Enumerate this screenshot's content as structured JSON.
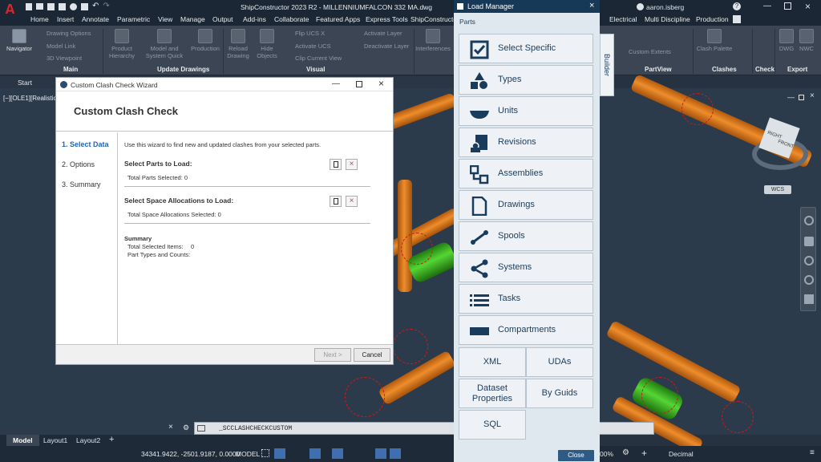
{
  "title_bar": {
    "title": "ShipConstructor 2023 R2 - MILLENNIUMFALCON    332 MA.dwg",
    "user": "aaron.isberg"
  },
  "menu": [
    "Home",
    "Insert",
    "Annotate",
    "Parametric",
    "View",
    "Manage",
    "Output",
    "Add-ins",
    "Collaborate",
    "Featured Apps",
    "Express Tools",
    "ShipConstructor"
  ],
  "menu_right": [
    "Electrical",
    "Multi Discipline",
    "Production"
  ],
  "ribbon": {
    "navigator": "Navigator",
    "drawing_options": "Drawing Options",
    "model_link": "Model Link",
    "viewpoint": "3D Viewpoint",
    "product_hierarchy": "Product Hierarchy",
    "model_system_quick": "Model and System Quick",
    "production": "Production",
    "reload_drawing": "Reload Drawing",
    "hide_objects": "Hide Objects",
    "flip_ucs": "Flip UCS X",
    "activate_ucs": "Activate UCS",
    "clip_current_view": "Clip Current View",
    "activate_layer": "Activate Layer",
    "deactivate_layer": "Deactivate Layer",
    "interferences": "Interferences",
    "custom_extents": "Custom Extents",
    "clash_palette": "Clash Palette",
    "dwg": "DWG",
    "nwc": "NWC",
    "panels": {
      "main": "Main",
      "update_drawings": "Update Drawings",
      "visual": "Visual",
      "partview": "PartView",
      "clashes": "Clashes",
      "check": "Check",
      "export": "Export"
    }
  },
  "tabs": {
    "start": "Start"
  },
  "viewport_label": "[−][OLE1][Realistic]",
  "viewcube": {
    "wcs": "WCS",
    "top_face": "RIGHT",
    "front_face": "FRONT"
  },
  "command_line": "_SCCLASHCHECKCUSTOM",
  "layout_tabs": [
    "Model",
    "Layout1",
    "Layout2"
  ],
  "status": {
    "coords": "34341.9422, -2501.9187, 0.0000",
    "model": "MODEL",
    "zoom": "00%",
    "units": "Decimal"
  },
  "wizard": {
    "window_title": "Custom Clash Check Wizard",
    "heading": "Custom Clash Check",
    "steps": [
      "1. Select Data",
      "2. Options",
      "3. Summary"
    ],
    "intro": "Use this wizard to find new and updated clashes from your selected parts.",
    "parts_heading": "Select Parts to Load:",
    "parts_count": "Total Parts Selected: 0",
    "spaces_heading": "Select Space Allocations to Load:",
    "spaces_count": "Total Space Allocations Selected: 0",
    "summary_heading": "Summary",
    "summary_total_label": "Total Selected Items:",
    "summary_total_value": "0",
    "summary_types": "Part Types and Counts:",
    "next": "Next >",
    "cancel": "Cancel"
  },
  "load_manager": {
    "title": "Load Manager",
    "section": "Parts",
    "builder_tab": "Builder",
    "items": [
      {
        "label": "Select Specific",
        "icon": "checkbox-icon"
      },
      {
        "label": "Types",
        "icon": "shapes-icon"
      },
      {
        "label": "Units",
        "icon": "bowl-icon"
      },
      {
        "label": "Revisions",
        "icon": "revisions-icon"
      },
      {
        "label": "Assemblies",
        "icon": "assemblies-icon"
      },
      {
        "label": "Drawings",
        "icon": "document-icon"
      },
      {
        "label": "Spools",
        "icon": "spool-icon"
      },
      {
        "label": "Systems",
        "icon": "share-icon"
      },
      {
        "label": "Tasks",
        "icon": "list-icon"
      },
      {
        "label": "Compartments",
        "icon": "compartment-icon"
      }
    ],
    "grid": [
      "XML",
      "UDAs",
      "Dataset Properties",
      "By Guids",
      "SQL"
    ],
    "close": "Close"
  }
}
